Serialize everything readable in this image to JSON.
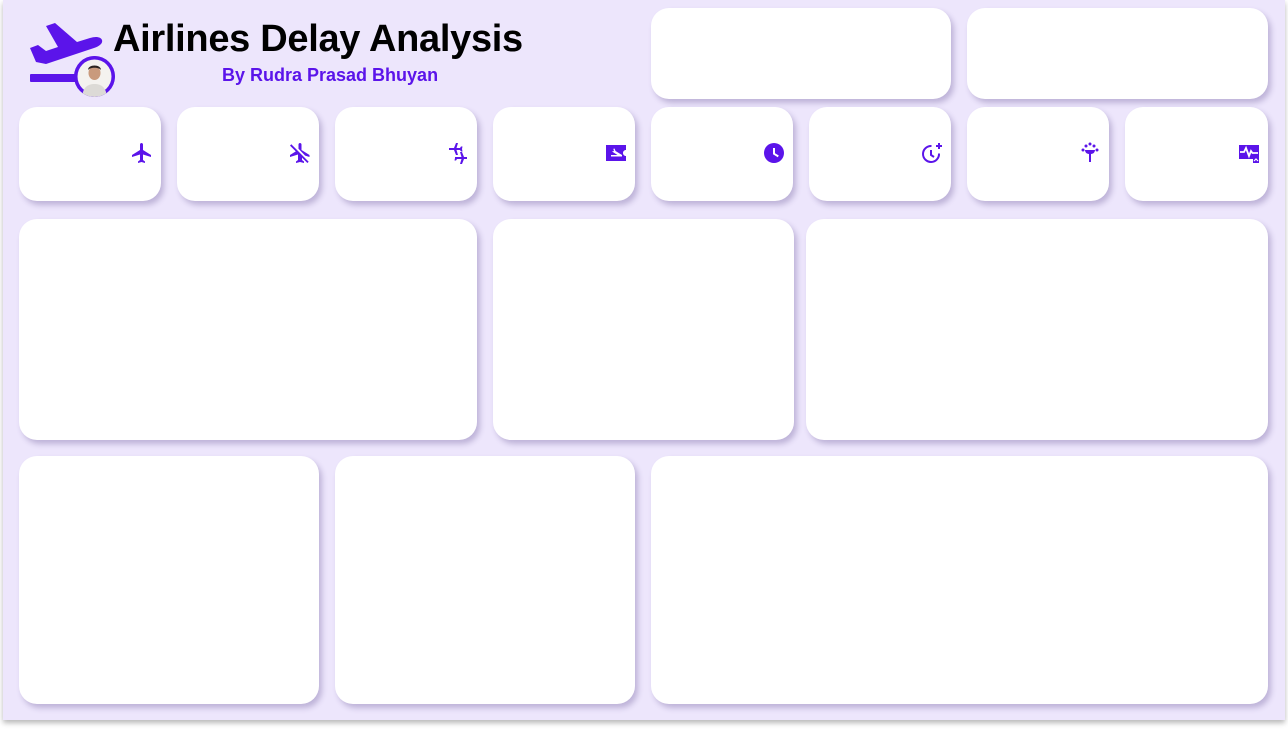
{
  "header": {
    "title": "Airlines Delay Analysis",
    "subtitle": "By Rudra Prasad Bhuyan",
    "logo_icon": "airplane-departure-icon",
    "avatar": "author-photo"
  },
  "theme": {
    "accent": "#5b14ea",
    "background": "#ede6fc",
    "card": "#ffffff",
    "title_color": "#000000"
  },
  "kpi_cards": [
    {
      "id": "kpi-1",
      "icon": "airplane-icon"
    },
    {
      "id": "kpi-2",
      "icon": "airplane-off-icon"
    },
    {
      "id": "kpi-3",
      "icon": "connecting-flights-icon"
    },
    {
      "id": "kpi-4",
      "icon": "flight-ticket-icon"
    },
    {
      "id": "kpi-5",
      "icon": "clock-icon"
    },
    {
      "id": "kpi-6",
      "icon": "clock-plus-icon"
    },
    {
      "id": "kpi-7",
      "icon": "weather-tree-icon"
    },
    {
      "id": "kpi-8",
      "icon": "heart-monitor-icon"
    }
  ],
  "panels": {
    "header_slots": [
      "slicer-1",
      "slicer-2"
    ],
    "chart_panels": [
      "chart-1",
      "chart-2",
      "chart-3",
      "chart-4",
      "chart-5",
      "chart-6"
    ]
  }
}
